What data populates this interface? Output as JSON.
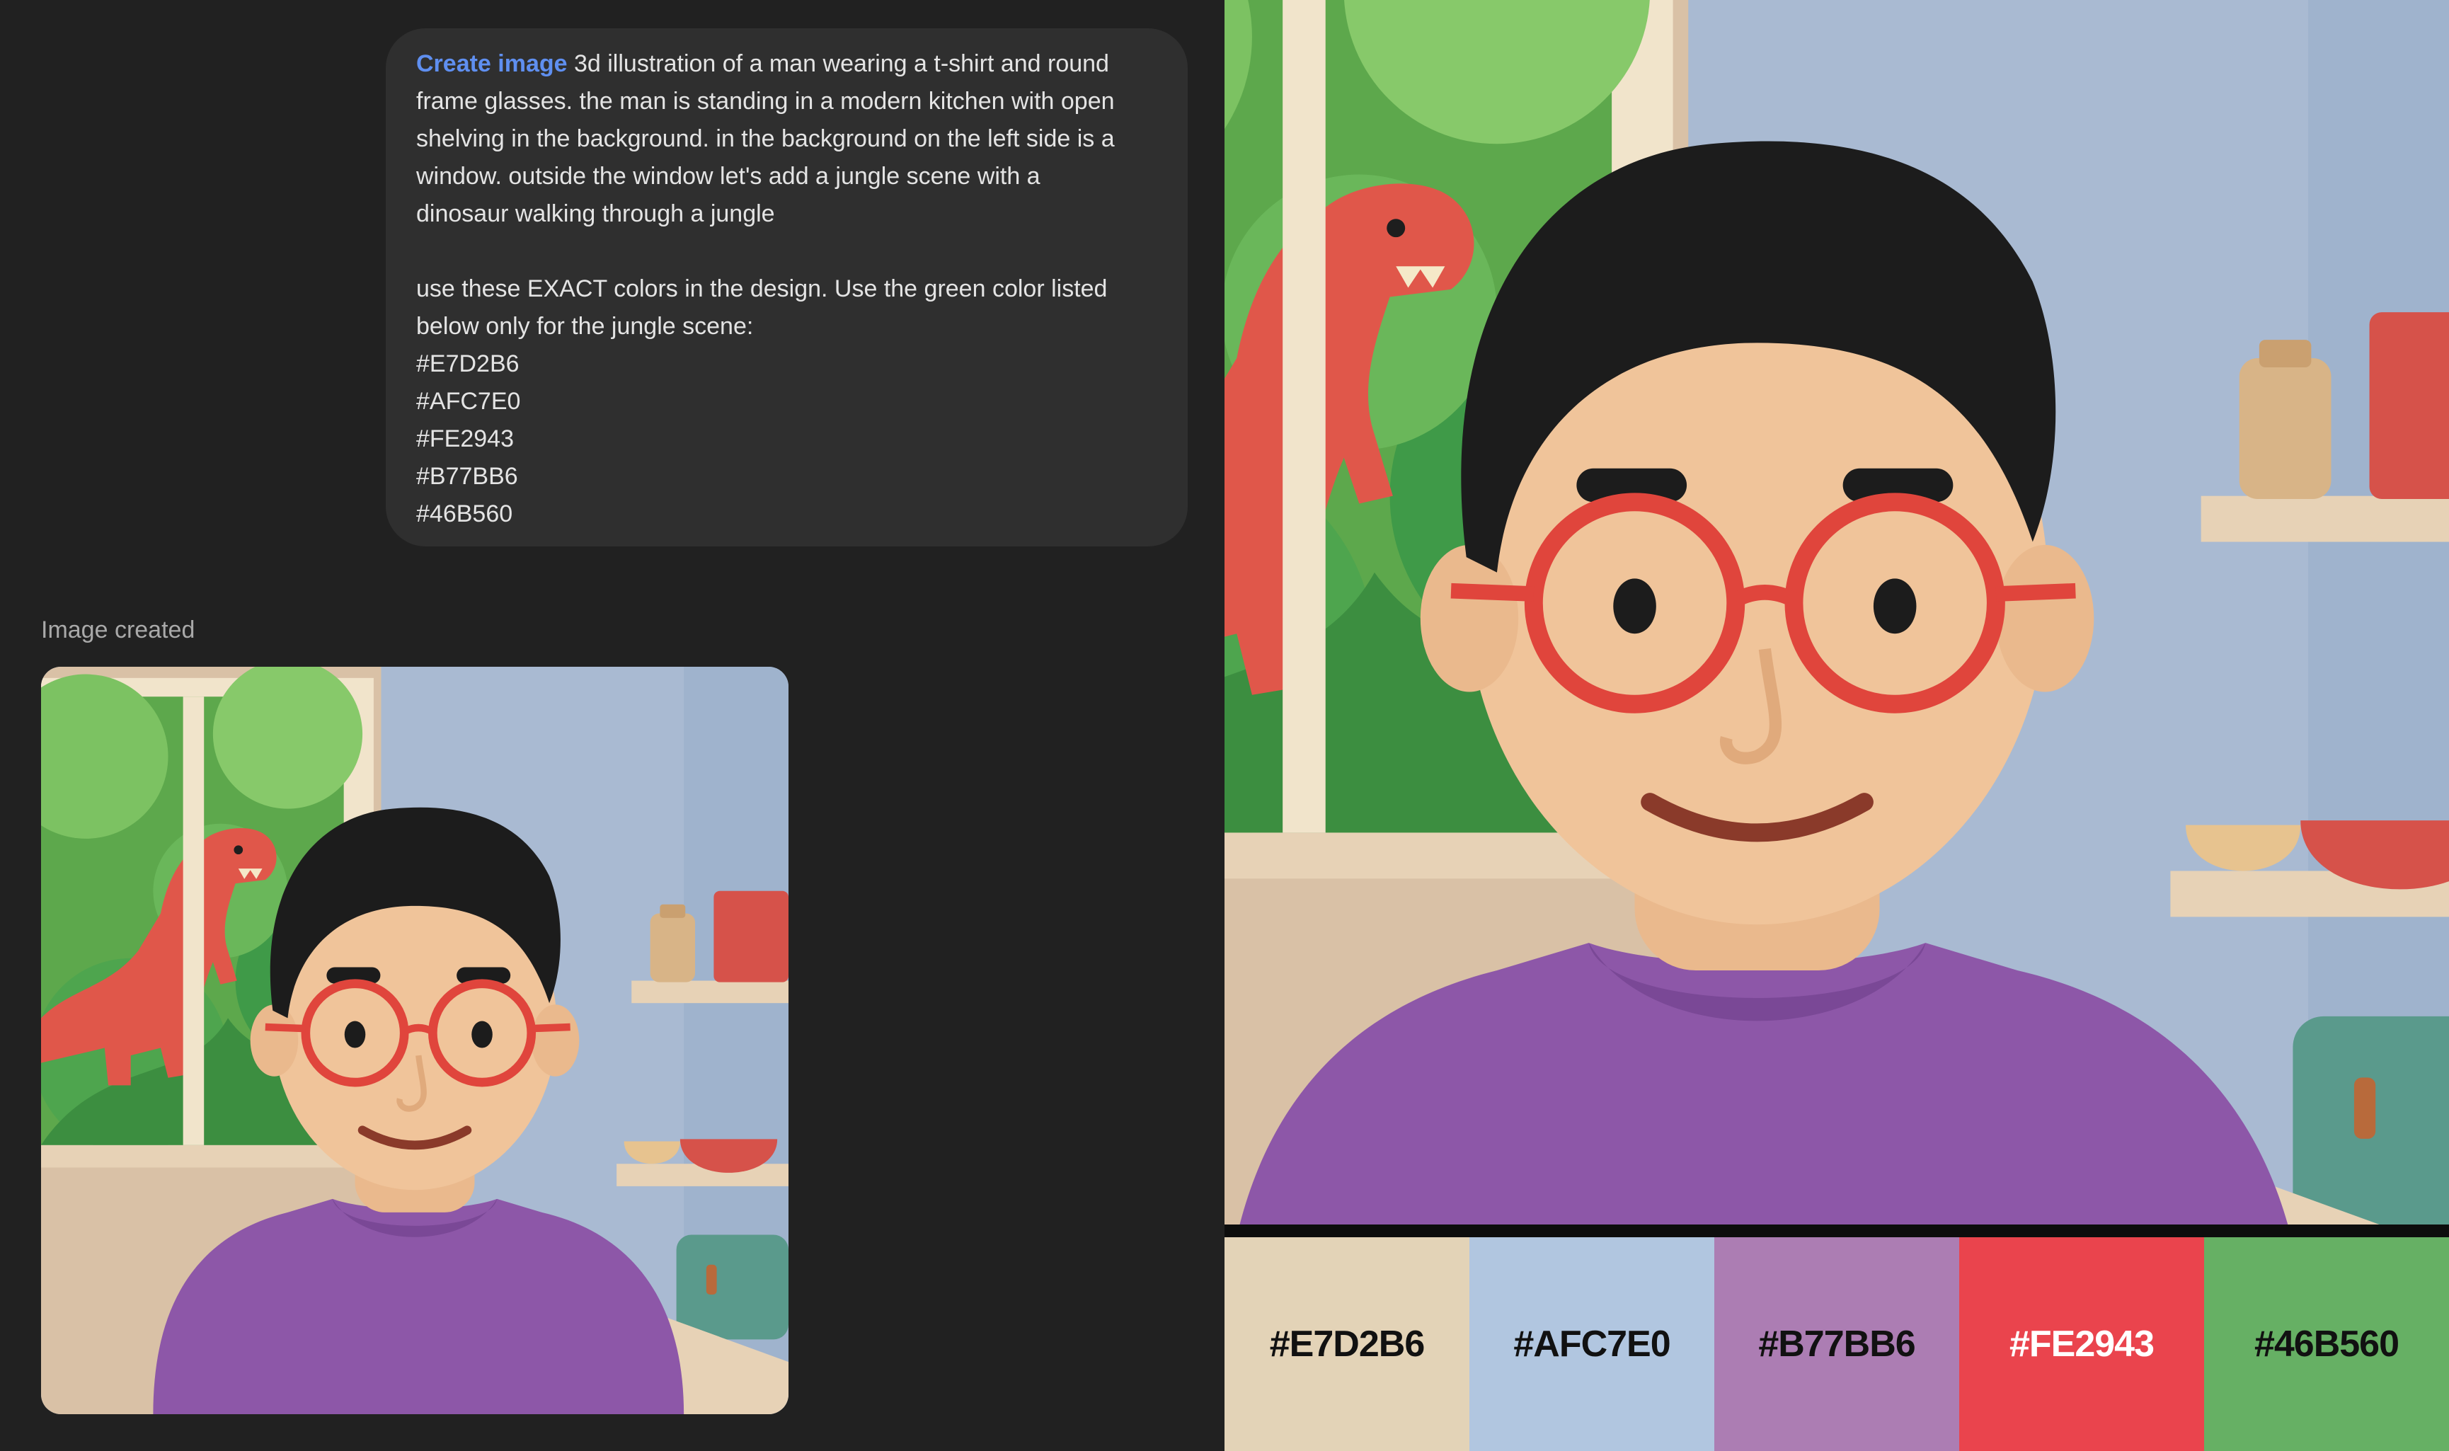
{
  "prompt": {
    "command": "Create image",
    "line1_rest": " 3d illustration of a man wearing a t-shirt and round",
    "lines": [
      "frame glasses. the man is standing in a modern kitchen with open",
      "shelving in the background. in the background on the left side is a",
      "window. outside the window let's add a jungle scene with a",
      "dinosaur walking through a jungle"
    ],
    "instruction_lines": [
      "use these EXACT colors in the design. Use the green color listed",
      "below only for the jungle scene:"
    ],
    "color_codes": [
      "#E7D2B6",
      "#AFC7E0",
      "#FE2943",
      "#B77BB6",
      "#46B560"
    ]
  },
  "result": {
    "status": "Image created"
  },
  "palette": {
    "swatches": [
      {
        "label": "#E7D2B6",
        "color": "#E3D3B7",
        "text_color": "#111111"
      },
      {
        "label": "#AFC7E0",
        "color": "#B1C6E0",
        "text_color": "#111111"
      },
      {
        "label": "#B77BB6",
        "color": "#AC7DB3",
        "text_color": "#111111"
      },
      {
        "label": "#FE2943",
        "color": "#EA444D",
        "text_color": "#FFFFFF"
      },
      {
        "label": "#46B560",
        "color": "#66B064",
        "text_color": "#111111"
      }
    ]
  },
  "colors": {
    "background": "#212121",
    "bubble": "#2F2F2F",
    "accent_link": "#5F8FF0",
    "wall": "#A9BAD2",
    "beige": "#E7D2B6",
    "jungle": "#46B560",
    "dino": "#E0574A",
    "shirt": "#8D57A8",
    "skin": "#F0C49A",
    "hair": "#1A1A1A",
    "glasses": "#E0453C"
  },
  "icons": [
    "illustration-image",
    "palette-swatch"
  ]
}
